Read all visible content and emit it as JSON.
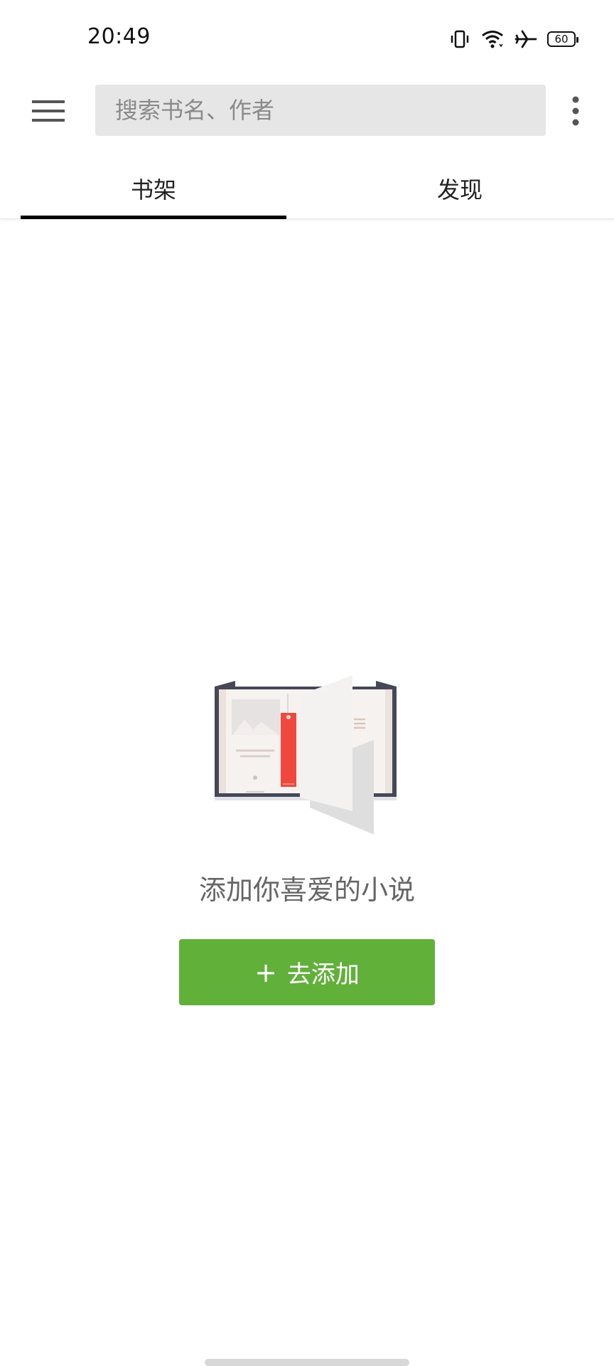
{
  "status_bar": {
    "time": "20:49",
    "battery_level": "60",
    "icons": [
      "vibrate-icon",
      "wifi-icon",
      "airplane-icon",
      "battery-icon"
    ]
  },
  "toolbar": {
    "menu_icon": "hamburger-menu-icon",
    "search_placeholder": "搜索书名、作者",
    "more_icon": "more-vertical-icon"
  },
  "tabs": [
    {
      "label": "书架",
      "selected": true
    },
    {
      "label": "发现",
      "selected": false
    }
  ],
  "empty_state": {
    "illustration": "open-book-bookmark-illustration",
    "message": "添加你喜爱的小说",
    "button_label": "去添加",
    "button_icon": "plus-icon"
  },
  "colors": {
    "accent": "#61b03a",
    "tab_indicator": "#000000",
    "search_bg": "#e6e6e6",
    "bookmark": "#f0483e"
  }
}
